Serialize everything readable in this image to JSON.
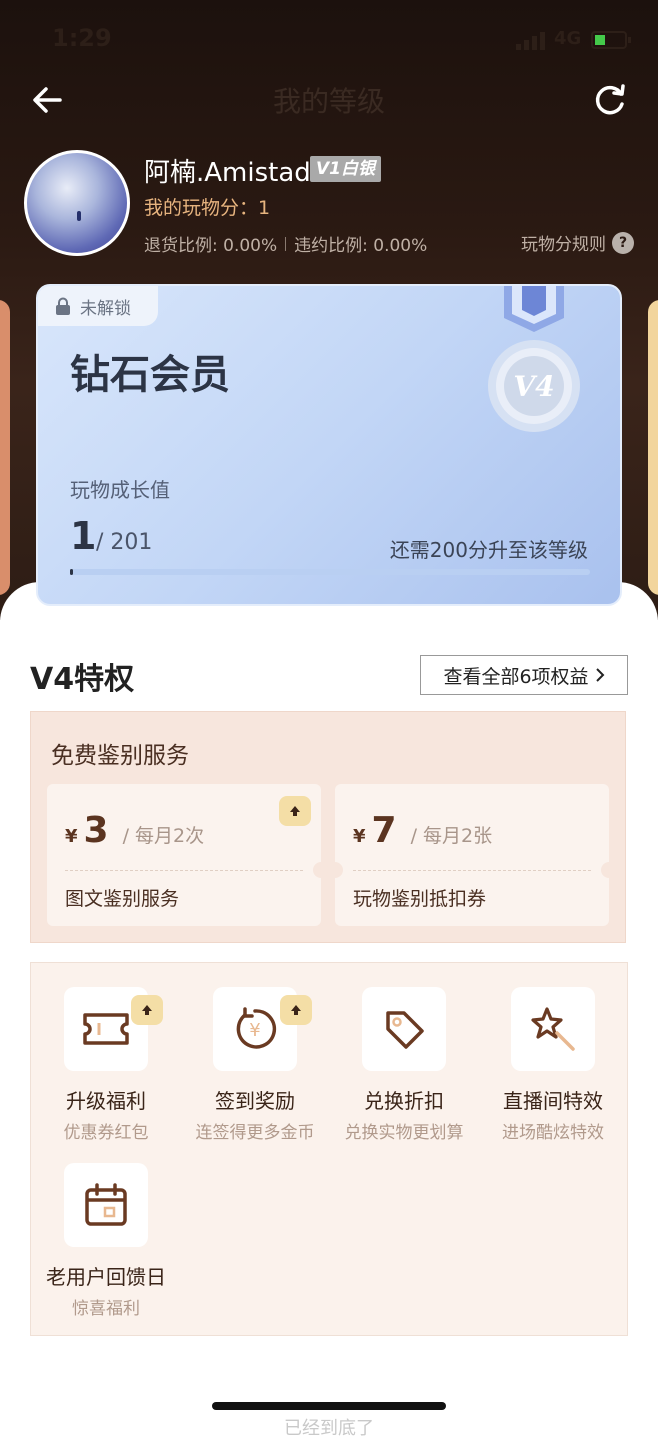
{
  "status_bar": {
    "time": "1:29",
    "network": "4G"
  },
  "nav": {
    "title": "我的等级",
    "back_icon": "arrow-left-icon",
    "refresh_icon": "refresh-icon"
  },
  "profile": {
    "username": "阿楠.Amistad",
    "level_badge": "V1白银",
    "score": "我的玩物分：1",
    "return_ratio": "退货比例: 0.00%",
    "breach_ratio": "违约比例: 0.00%",
    "rules_link": "玩物分规则",
    "rules_icon": "?"
  },
  "level_card": {
    "lock_label": "未解锁",
    "title": "钻石会员",
    "medal_text": "V4",
    "growth_label": "玩物成长值",
    "growth_current": "1",
    "growth_total": "/ 201",
    "growth_progress": 0.005,
    "remaining": "还需200分升至该等级",
    "colors": {
      "card": "#c2d6f6",
      "text": "#2c3445"
    }
  },
  "privileges": {
    "title": "V4特权",
    "view_all": "查看全部6项权益",
    "free_service": {
      "title": "免费鉴别服务",
      "tickets": [
        {
          "currency": "¥",
          "amount": "3",
          "per": "/ 每月2次",
          "name": "图文鉴别服务",
          "upgrade": true
        },
        {
          "currency": "¥",
          "amount": "7",
          "per": "/ 每月2张",
          "name": "玩物鉴别抵扣券",
          "upgrade": false
        }
      ]
    },
    "benefits": [
      {
        "name": "升级福利",
        "sub": "优惠券红包",
        "icon": "ticket-icon",
        "upgrade": true
      },
      {
        "name": "签到奖励",
        "sub": "连签得更多金币",
        "icon": "coin-yen-icon",
        "upgrade": true
      },
      {
        "name": "兑换折扣",
        "sub": "兑换实物更划算",
        "icon": "price-tag-icon",
        "upgrade": false
      },
      {
        "name": "直播间特效",
        "sub": "进场酷炫特效",
        "icon": "magic-wand-icon",
        "upgrade": false
      },
      {
        "name": "老用户回馈日",
        "sub": "惊喜福利",
        "icon": "calendar-icon",
        "upgrade": false
      }
    ]
  },
  "bottom_hint": "已经到底了",
  "colors": {
    "brown_text": "#5b3420",
    "accent_gold": "#e7b47f",
    "service_bg": "#f7e6dd"
  }
}
